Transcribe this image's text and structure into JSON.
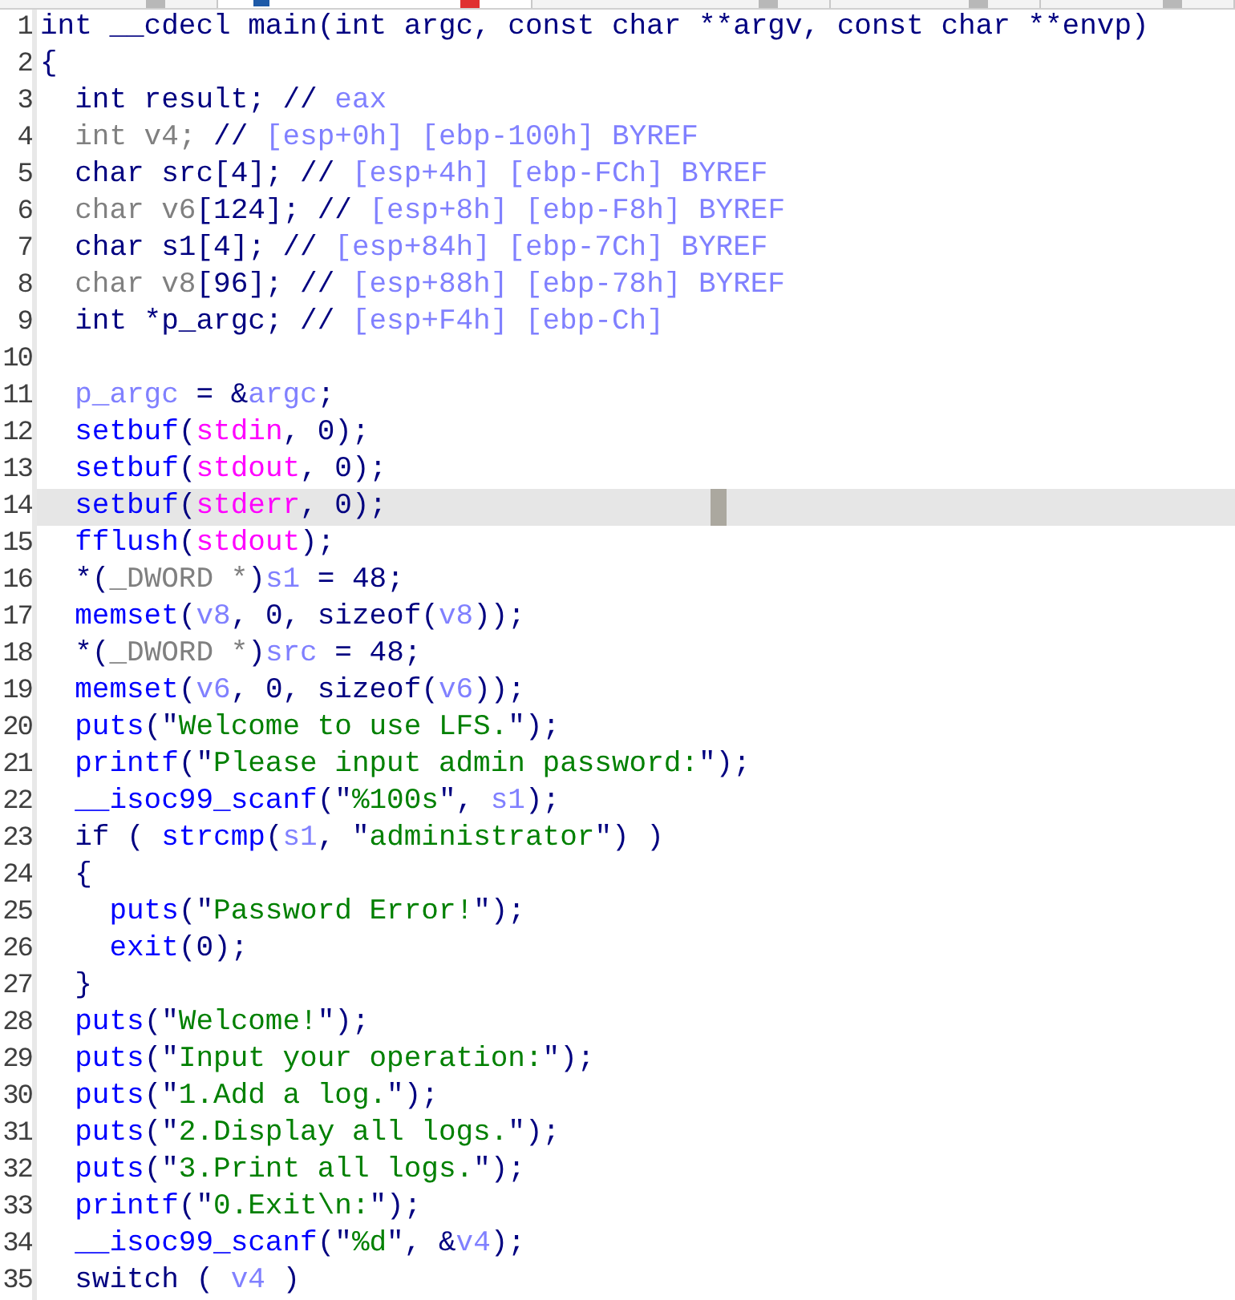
{
  "tabs": [
    {
      "selected": false
    },
    {
      "selected": true
    },
    {
      "selected": false
    },
    {
      "selected": false
    },
    {
      "selected": false
    }
  ],
  "code_lines": [
    {
      "number": "1",
      "selected": false,
      "segments": [
        {
          "text": "int __cdecl main(int argc, const char **argv, const char **envp)",
          "kind": "plain"
        }
      ]
    },
    {
      "number": "2",
      "selected": false,
      "segments": [
        {
          "text": "{",
          "kind": "plain"
        }
      ]
    },
    {
      "number": "3",
      "selected": false,
      "segments": [
        {
          "text": "  int result; // ",
          "kind": "plain"
        },
        {
          "text": "eax",
          "kind": "var"
        }
      ]
    },
    {
      "number": "4",
      "selected": false,
      "segments": [
        {
          "text": "  int v4; ",
          "kind": "gray"
        },
        {
          "text": "// ",
          "kind": "plain"
        },
        {
          "text": "[esp+0h] [ebp-100h] BYREF",
          "kind": "var"
        }
      ]
    },
    {
      "number": "5",
      "selected": false,
      "segments": [
        {
          "text": "  char src[4]; // ",
          "kind": "plain"
        },
        {
          "text": "[esp+4h] [ebp-FCh] BYREF",
          "kind": "var"
        }
      ]
    },
    {
      "number": "6",
      "selected": false,
      "segments": [
        {
          "text": "  char v6",
          "kind": "gray"
        },
        {
          "text": "[124]; // ",
          "kind": "plain"
        },
        {
          "text": "[esp+8h] [ebp-F8h] BYREF",
          "kind": "var"
        }
      ]
    },
    {
      "number": "7",
      "selected": false,
      "segments": [
        {
          "text": "  char s1[4]; // ",
          "kind": "plain"
        },
        {
          "text": "[esp+84h] [ebp-7Ch] BYREF",
          "kind": "var"
        }
      ]
    },
    {
      "number": "8",
      "selected": false,
      "segments": [
        {
          "text": "  char v8",
          "kind": "gray"
        },
        {
          "text": "[96]; // ",
          "kind": "plain"
        },
        {
          "text": "[esp+88h] [ebp-78h] BYREF",
          "kind": "var"
        }
      ]
    },
    {
      "number": "9",
      "selected": false,
      "segments": [
        {
          "text": "  int *p_argc; // ",
          "kind": "plain"
        },
        {
          "text": "[esp+F4h] [ebp-Ch]",
          "kind": "var"
        }
      ]
    },
    {
      "number": "10",
      "selected": false
    },
    {
      "number": "11",
      "selected": false,
      "segments": [
        {
          "text": "  p_argc",
          "kind": "var"
        },
        {
          "text": " = &",
          "kind": "plain"
        },
        {
          "text": "argc",
          "kind": "var"
        },
        {
          "text": ";",
          "kind": "plain"
        }
      ]
    },
    {
      "number": "12",
      "selected": false,
      "segments": [
        {
          "text": "  setbuf",
          "kind": "func"
        },
        {
          "text": "(",
          "kind": "plain"
        },
        {
          "text": "stdin",
          "kind": "magenta"
        },
        {
          "text": ", 0);",
          "kind": "plain"
        }
      ]
    },
    {
      "number": "13",
      "selected": false,
      "segments": [
        {
          "text": "  setbuf",
          "kind": "func"
        },
        {
          "text": "(",
          "kind": "plain"
        },
        {
          "text": "stdout",
          "kind": "magenta"
        },
        {
          "text": ", 0);",
          "kind": "plain"
        }
      ]
    },
    {
      "number": "14",
      "selected": true,
      "segments": [
        {
          "text": "  setbuf",
          "kind": "func"
        },
        {
          "text": "(",
          "kind": "plain"
        },
        {
          "text": "stderr",
          "kind": "magenta"
        },
        {
          "text": ", 0);",
          "kind": "plain"
        }
      ]
    },
    {
      "number": "15",
      "selected": false,
      "segments": [
        {
          "text": "  fflush",
          "kind": "func"
        },
        {
          "text": "(",
          "kind": "plain"
        },
        {
          "text": "stdout",
          "kind": "magenta"
        },
        {
          "text": ");",
          "kind": "plain"
        }
      ]
    },
    {
      "number": "16",
      "selected": false,
      "segments": [
        {
          "text": "  *(",
          "kind": "plain"
        },
        {
          "text": "_DWORD *",
          "kind": "gray"
        },
        {
          "text": ")",
          "kind": "plain"
        },
        {
          "text": "s1",
          "kind": "var"
        },
        {
          "text": " = 48;",
          "kind": "plain"
        }
      ]
    },
    {
      "number": "17",
      "selected": false,
      "segments": [
        {
          "text": "  memset",
          "kind": "func"
        },
        {
          "text": "(",
          "kind": "plain"
        },
        {
          "text": "v8",
          "kind": "var"
        },
        {
          "text": ", 0, sizeof(",
          "kind": "plain"
        },
        {
          "text": "v8",
          "kind": "var"
        },
        {
          "text": "));",
          "kind": "plain"
        }
      ]
    },
    {
      "number": "18",
      "selected": false,
      "segments": [
        {
          "text": "  *(",
          "kind": "plain"
        },
        {
          "text": "_DWORD *",
          "kind": "gray"
        },
        {
          "text": ")",
          "kind": "plain"
        },
        {
          "text": "src",
          "kind": "var"
        },
        {
          "text": " = 48;",
          "kind": "plain"
        }
      ]
    },
    {
      "number": "19",
      "selected": false,
      "segments": [
        {
          "text": "  memset",
          "kind": "func"
        },
        {
          "text": "(",
          "kind": "plain"
        },
        {
          "text": "v6",
          "kind": "var"
        },
        {
          "text": ", 0, sizeof(",
          "kind": "plain"
        },
        {
          "text": "v6",
          "kind": "var"
        },
        {
          "text": "));",
          "kind": "plain"
        }
      ]
    },
    {
      "number": "20",
      "selected": false,
      "segments": [
        {
          "text": "  puts",
          "kind": "func"
        },
        {
          "text": "(\"",
          "kind": "plain"
        },
        {
          "text": "Welcome to use LFS.",
          "kind": "str"
        },
        {
          "text": "\");",
          "kind": "plain"
        }
      ]
    },
    {
      "number": "21",
      "selected": false,
      "segments": [
        {
          "text": "  printf",
          "kind": "func"
        },
        {
          "text": "(\"",
          "kind": "plain"
        },
        {
          "text": "Please input admin password:",
          "kind": "str"
        },
        {
          "text": "\");",
          "kind": "plain"
        }
      ]
    },
    {
      "number": "22",
      "selected": false,
      "segments": [
        {
          "text": "  __isoc99_scanf",
          "kind": "func"
        },
        {
          "text": "(\"",
          "kind": "plain"
        },
        {
          "text": "%100s",
          "kind": "str"
        },
        {
          "text": "\", ",
          "kind": "plain"
        },
        {
          "text": "s1",
          "kind": "var"
        },
        {
          "text": ");",
          "kind": "plain"
        }
      ]
    },
    {
      "number": "23",
      "selected": false,
      "segments": [
        {
          "text": "  if ( ",
          "kind": "plain"
        },
        {
          "text": "strcmp",
          "kind": "func"
        },
        {
          "text": "(",
          "kind": "plain"
        },
        {
          "text": "s1",
          "kind": "var"
        },
        {
          "text": ", \"",
          "kind": "plain"
        },
        {
          "text": "administrator",
          "kind": "str"
        },
        {
          "text": "\") )",
          "kind": "plain"
        }
      ]
    },
    {
      "number": "24",
      "selected": false,
      "segments": [
        {
          "text": "  {",
          "kind": "plain"
        }
      ]
    },
    {
      "number": "25",
      "selected": false,
      "segments": [
        {
          "text": "    puts",
          "kind": "func"
        },
        {
          "text": "(\"",
          "kind": "plain"
        },
        {
          "text": "Password Error!",
          "kind": "str"
        },
        {
          "text": "\");",
          "kind": "plain"
        }
      ]
    },
    {
      "number": "26",
      "selected": false,
      "segments": [
        {
          "text": "    exit",
          "kind": "func"
        },
        {
          "text": "(0);",
          "kind": "plain"
        }
      ]
    },
    {
      "number": "27",
      "selected": false,
      "segments": [
        {
          "text": "  }",
          "kind": "plain"
        }
      ]
    },
    {
      "number": "28",
      "selected": false,
      "segments": [
        {
          "text": "  puts",
          "kind": "func"
        },
        {
          "text": "(\"",
          "kind": "plain"
        },
        {
          "text": "Welcome!",
          "kind": "str"
        },
        {
          "text": "\");",
          "kind": "plain"
        }
      ]
    },
    {
      "number": "29",
      "selected": false,
      "segments": [
        {
          "text": "  puts",
          "kind": "func"
        },
        {
          "text": "(\"",
          "kind": "plain"
        },
        {
          "text": "Input your operation:",
          "kind": "str"
        },
        {
          "text": "\");",
          "kind": "plain"
        }
      ]
    },
    {
      "number": "30",
      "selected": false,
      "segments": [
        {
          "text": "  puts",
          "kind": "func"
        },
        {
          "text": "(\"",
          "kind": "plain"
        },
        {
          "text": "1.Add a log.",
          "kind": "str"
        },
        {
          "text": "\");",
          "kind": "plain"
        }
      ]
    },
    {
      "number": "31",
      "selected": false,
      "segments": [
        {
          "text": "  puts",
          "kind": "func"
        },
        {
          "text": "(\"",
          "kind": "plain"
        },
        {
          "text": "2.Display all logs.",
          "kind": "str"
        },
        {
          "text": "\");",
          "kind": "plain"
        }
      ]
    },
    {
      "number": "32",
      "selected": false,
      "segments": [
        {
          "text": "  puts",
          "kind": "func"
        },
        {
          "text": "(\"",
          "kind": "plain"
        },
        {
          "text": "3.Print all logs.",
          "kind": "str"
        },
        {
          "text": "\");",
          "kind": "plain"
        }
      ]
    },
    {
      "number": "33",
      "selected": false,
      "segments": [
        {
          "text": "  printf",
          "kind": "func"
        },
        {
          "text": "(\"",
          "kind": "plain"
        },
        {
          "text": "0.Exit\\n:",
          "kind": "str"
        },
        {
          "text": "\");",
          "kind": "plain"
        }
      ]
    },
    {
      "number": "34",
      "selected": false,
      "segments": [
        {
          "text": "  __isoc99_scanf",
          "kind": "func"
        },
        {
          "text": "(\"",
          "kind": "plain"
        },
        {
          "text": "%d",
          "kind": "str"
        },
        {
          "text": "\", &",
          "kind": "plain"
        },
        {
          "text": "v4",
          "kind": "var"
        },
        {
          "text": ");",
          "kind": "plain"
        }
      ]
    },
    {
      "number": "35",
      "selected": false,
      "segments": [
        {
          "text": "  switch ( ",
          "kind": "plain"
        },
        {
          "text": "v4",
          "kind": "var"
        },
        {
          "text": " )",
          "kind": "plain"
        }
      ]
    }
  ]
}
